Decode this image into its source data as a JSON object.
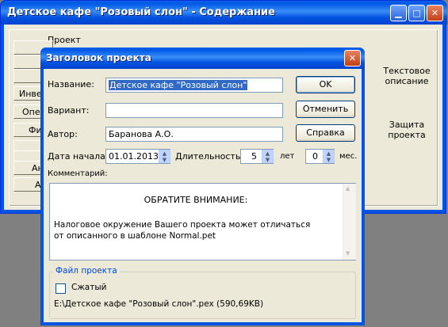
{
  "main_window": {
    "title": "Детское кафе \"Розовый слон\" - Содержание",
    "panel_label": "Проект",
    "left_buttons": [
      "",
      "",
      "",
      "Инве",
      "Опер",
      "Фи",
      "",
      "",
      "Ан",
      "А"
    ],
    "right_items": [
      "Текстовое описание",
      "Защита проекта"
    ]
  },
  "dialog": {
    "title": "Заголовок проекта",
    "fields": {
      "name_label": "Название:",
      "name_value": "Детское кафе \"Розовый слон\"",
      "variant_label": "Вариант:",
      "variant_value": "",
      "author_label": "Автор:",
      "author_value": "Баранова А.О.",
      "start_label": "Дата начала:",
      "start_value": "01.01.2013",
      "duration_label": "Длительность:",
      "years_value": "5",
      "years_unit": "лет",
      "months_value": "0",
      "months_unit": "мес.",
      "comment_label": "Комментарий:"
    },
    "comment": {
      "heading": "ОБРАТИТЕ ВНИМАНИЕ:",
      "body": "Налоговое окружение Вашего проекта может отличаться от описанного в шаблоне Normal.pet"
    },
    "buttons": {
      "ok": "OK",
      "cancel": "Отменить",
      "help": "Справка"
    },
    "file_group": {
      "label": "Файл проекта",
      "compressed_label": "Сжатый",
      "compressed_checked": false,
      "path": "E:\\Детское кафе \"Розовый слон\".pex (590,69KB)"
    }
  },
  "colors": {
    "titlebar": "#0054e3",
    "face": "#ece9d8",
    "selection": "#316ac5"
  },
  "icons": [
    "minimize-icon",
    "maximize-icon",
    "close-icon",
    "spin-up-icon",
    "spin-down-icon",
    "scroll-up-icon",
    "scroll-down-icon"
  ]
}
